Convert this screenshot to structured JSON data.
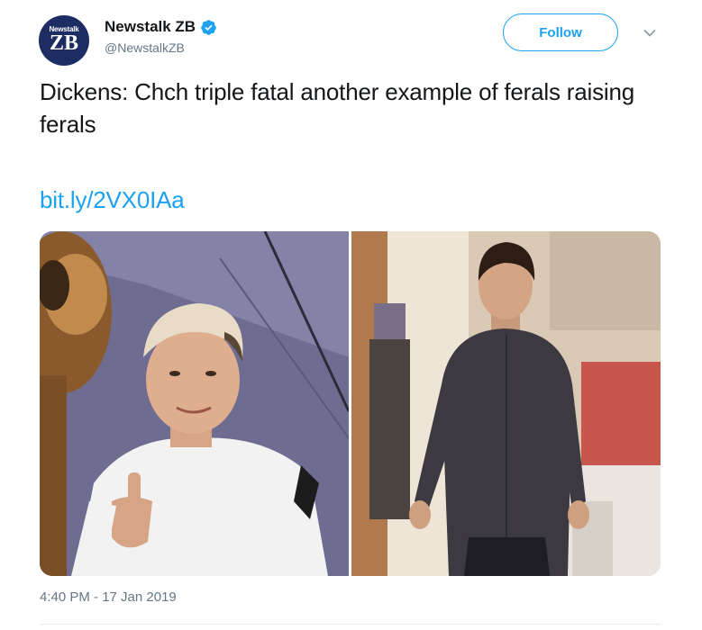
{
  "account": {
    "avatar_small_text": "Newstalk",
    "avatar_big_text": "ZB",
    "display_name": "Newstalk ZB",
    "handle": "@NewstalkZB",
    "verified": true
  },
  "actions": {
    "follow_label": "Follow",
    "more_icon": "chevron-down-icon"
  },
  "tweet": {
    "text": "Dickens: Chch triple fatal another example of ferals raising ferals",
    "link": "bit.ly/2VX0IAa",
    "timestamp": "4:40 PM - 17 Jan 2019"
  },
  "media": {
    "photos": [
      {
        "description": "boy with bleached hair in white t-shirt giving thumbs up beside a costume mascot"
      },
      {
        "description": "teenager in dark button-up shirt standing in a room"
      }
    ]
  },
  "colors": {
    "brand_blue": "#1da1f2",
    "secondary_text": "#657786",
    "primary_text": "#14171a",
    "avatar_bg": "#1d2c63"
  }
}
